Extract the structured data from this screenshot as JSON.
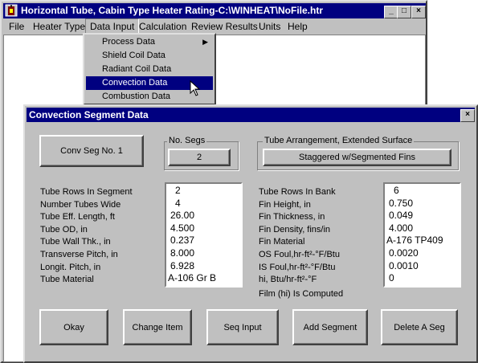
{
  "main_window": {
    "title": "Horizontal Tube, Cabin Type Heater Rating-C:\\WINHEAT\\NoFile.htr",
    "menu": [
      "File",
      "Heater Type",
      "Data Input",
      "Calculation",
      "Review Results",
      "Units",
      "Help"
    ],
    "controls": {
      "minimize": "_",
      "maximize": "□",
      "close": "×"
    }
  },
  "data_input_menu": {
    "items": [
      "Process Data",
      "Shield Coil Data",
      "Radiant Coil Data",
      "Convection Data",
      "Combustion Data"
    ],
    "highlighted": "Convection Data"
  },
  "dialog": {
    "title": "Convection Segment Data",
    "close": "×",
    "segment_button": "Conv Seg No. 1",
    "no_segs": {
      "label": "No. Segs",
      "value": "2"
    },
    "tube_arrangement": {
      "label": "Tube Arrangement, Extended Surface",
      "value": "Staggered w/Segmented Fins"
    },
    "left_labels": [
      "Tube Rows In Segment",
      "Number Tubes Wide",
      "Tube Eff. Length, ft",
      "Tube OD, in",
      "Tube Wall Thk., in",
      "Transverse Pitch, in",
      "Longit. Pitch, in",
      "Tube Material"
    ],
    "left_values": [
      "2",
      "4",
      "26.00",
      "4.500",
      "0.237",
      "8.000",
      "6.928",
      "A-106 Gr B"
    ],
    "right_labels": [
      "Tube Rows In Bank",
      "Fin Height, in",
      "Fin Thickness, in",
      "Fin Density, fins/in",
      "Fin Material",
      "OS Foul,hr-ft²-°F/Btu",
      "IS Foul,hr-ft²-°F/Btu",
      "hi, Btu/hr-ft²-°F",
      "Film (hi) Is Computed"
    ],
    "right_values": [
      "6",
      "0.750",
      "0.049",
      "4.000",
      "A-176 TP409",
      "0.0020",
      "0.0010",
      "0"
    ],
    "buttons": [
      "Okay",
      "Change Item",
      "Seq Input",
      "Add Segment",
      "Delete A Seg"
    ]
  }
}
